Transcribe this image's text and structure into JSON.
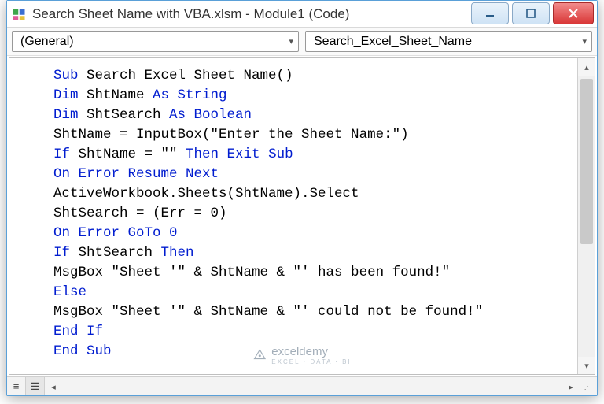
{
  "window": {
    "title": "Search Sheet Name with VBA.xlsm - Module1 (Code)"
  },
  "toolbar": {
    "object_dropdown": "(General)",
    "procedure_dropdown": "Search_Excel_Sheet_Name"
  },
  "code": {
    "lines": [
      [
        [
          "kw",
          "Sub"
        ],
        [
          "txt",
          " Search_Excel_Sheet_Name()"
        ]
      ],
      [
        [
          "kw",
          "Dim"
        ],
        [
          "txt",
          " ShtName "
        ],
        [
          "kw",
          "As String"
        ]
      ],
      [
        [
          "kw",
          "Dim"
        ],
        [
          "txt",
          " ShtSearch "
        ],
        [
          "kw",
          "As Boolean"
        ]
      ],
      [
        [
          "txt",
          "ShtName = InputBox(\"Enter the Sheet Name:\")"
        ]
      ],
      [
        [
          "kw",
          "If"
        ],
        [
          "txt",
          " ShtName = \"\" "
        ],
        [
          "kw",
          "Then Exit Sub"
        ]
      ],
      [
        [
          "kw",
          "On Error Resume Next"
        ]
      ],
      [
        [
          "txt",
          "ActiveWorkbook.Sheets(ShtName).Select"
        ]
      ],
      [
        [
          "txt",
          "ShtSearch = (Err = 0)"
        ]
      ],
      [
        [
          "kw",
          "On Error GoTo 0"
        ]
      ],
      [
        [
          "kw",
          "If"
        ],
        [
          "txt",
          " ShtSearch "
        ],
        [
          "kw",
          "Then"
        ]
      ],
      [
        [
          "txt",
          "MsgBox \"Sheet '\" & ShtName & \"' has been found!\""
        ]
      ],
      [
        [
          "kw",
          "Else"
        ]
      ],
      [
        [
          "txt",
          "MsgBox \"Sheet '\" & ShtName & \"' could not be found!\""
        ]
      ],
      [
        [
          "kw",
          "End If"
        ]
      ],
      [
        [
          "kw",
          "End Sub"
        ]
      ]
    ]
  },
  "watermark": {
    "brand": "exceldemy",
    "tagline": "EXCEL · DATA · BI"
  }
}
